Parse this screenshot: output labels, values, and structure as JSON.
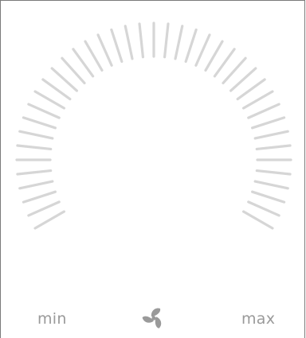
{
  "dial": {
    "min_label": "min",
    "max_label": "max",
    "level": 0,
    "tick_color": "#d6d6d6",
    "active_tick_color": "#9a9a9a"
  },
  "icons": {
    "fan": "fan-icon"
  },
  "colors": {
    "label": "#9a9a9a",
    "fan": "#9a9a9a"
  }
}
